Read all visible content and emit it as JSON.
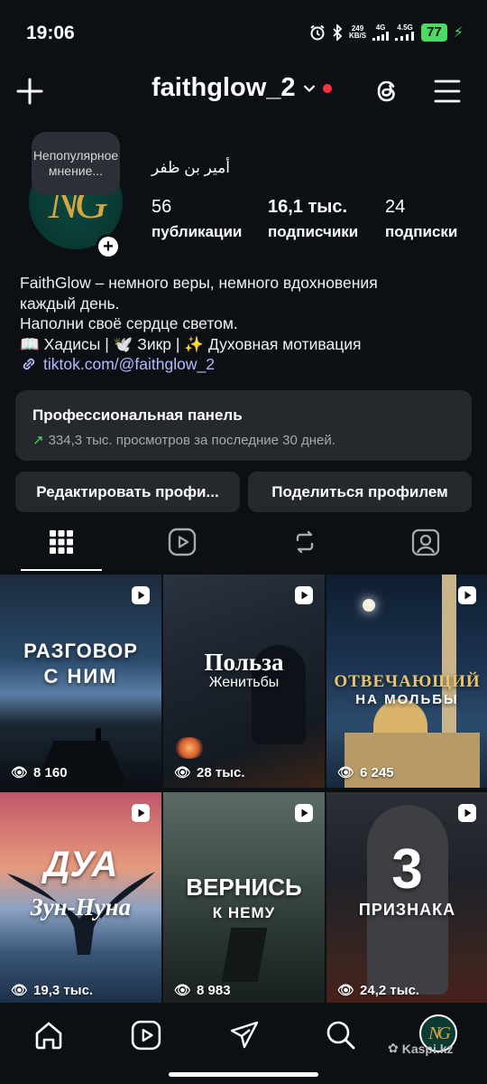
{
  "status_bar": {
    "time": "19:06",
    "net_speed_value": "249",
    "net_speed_unit": "KB/S",
    "net_type_1": "4G",
    "net_type_2": "4.5G",
    "battery": "77"
  },
  "header": {
    "username": "faithglow_2",
    "icons": [
      "plus-icon",
      "chevron-down-icon",
      "threads-icon",
      "hamburger-menu-icon"
    ]
  },
  "profile": {
    "note": "Непопулярное мнение...",
    "display_name": "أمير بن ظفر",
    "avatar_logo": "NG",
    "stats": [
      {
        "value": "56",
        "label": "публикации"
      },
      {
        "value": "16,1 тыс.",
        "label": "подписчики"
      },
      {
        "value": "24",
        "label": "подписки"
      }
    ],
    "bio_lines": [
      "FaithGlow – немного веры, немного вдохновения",
      "каждый день.",
      "Наполни своё сердце светом.",
      "📖 Хадисы | 🕊️ Зикр | ✨ Духовная мотивация"
    ],
    "link": "tiktok.com/@faithglow_2"
  },
  "pro_panel": {
    "title": "Профессиональная панель",
    "subtitle": "334,3 тыс. просмотров за последние 30 дней."
  },
  "buttons": {
    "edit": "Редактировать профи...",
    "share": "Поделиться профилем"
  },
  "tabs": [
    "grid-icon",
    "reels-icon",
    "reposts-icon",
    "tagged-icon"
  ],
  "posts": [
    {
      "title_1": "РАЗГОВОР",
      "title_2": "С НИМ",
      "views": "8 160"
    },
    {
      "title_1": "Польза",
      "title_2": "Женитьбы",
      "views": "28 тыс."
    },
    {
      "title_1": "ОТВЕЧАЮЩИЙ",
      "title_2": "НА МОЛЬБЫ",
      "views": "6 245"
    },
    {
      "title_1": "ДУА",
      "title_2": "Зун-Нуна",
      "views": "19,3 тыс."
    },
    {
      "title_1": "ВЕРНИСЬ",
      "title_2": "К НЕМУ",
      "views": "8 983"
    },
    {
      "title_1": "3",
      "title_2": "ПРИЗНАКА",
      "views": "24,2 тыс."
    }
  ],
  "bottom_nav": {
    "items": [
      "home-icon",
      "reels-icon",
      "direct-icon",
      "search-icon",
      "profile-avatar"
    ],
    "avatar_logo": "NG",
    "watermark": "Kaspi.kz"
  },
  "colors": {
    "background": "#0c1014",
    "panel": "#25292e",
    "link": "#b5b9ff",
    "accent_red": "#ff3040",
    "battery_green": "#4cd964",
    "logo_gold": "#d7a640"
  }
}
